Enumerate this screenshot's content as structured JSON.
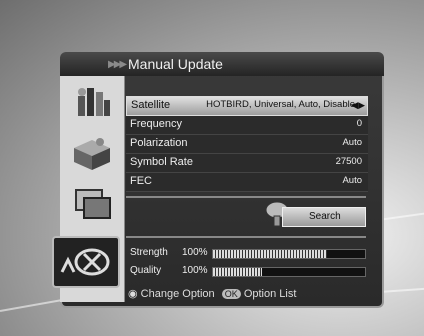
{
  "title": "Manual Update",
  "menu": {
    "rows": [
      {
        "label": "Satellite",
        "value": "HOTBIRD, Universal, Auto, Disable",
        "selected": true
      },
      {
        "label": "Frequency",
        "value": "0"
      },
      {
        "label": "Polarization",
        "value": "Auto"
      },
      {
        "label": "Symbol Rate",
        "value": "27500"
      },
      {
        "label": "FEC",
        "value": "Auto"
      }
    ],
    "search_label": "Search"
  },
  "signal": {
    "strength_label": "Strength",
    "strength_pct": "100%",
    "strength_level": 0.75,
    "quality_label": "Quality",
    "quality_pct": "100%",
    "quality_level": 0.32
  },
  "footer": {
    "change_option": "Change Option",
    "ok_key": "OK",
    "option_list": "Option List"
  },
  "icons": [
    "installation-icon",
    "package-icon",
    "monitor-icon",
    "satellite-dish-icon"
  ]
}
